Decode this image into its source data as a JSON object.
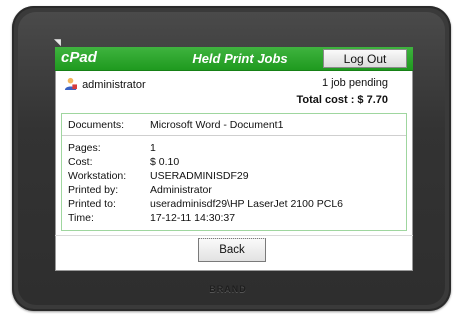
{
  "header": {
    "brand": "cPad",
    "title": "Held Print Jobs",
    "logout_label": "Log Out"
  },
  "summary": {
    "username": "administrator",
    "pending": "1 job pending",
    "total_cost": "Total cost : $ 7.70"
  },
  "job": {
    "documents_label": "Documents:",
    "documents_value": "Microsoft Word - Document1",
    "fields": [
      {
        "label": "Pages:",
        "value": "1"
      },
      {
        "label": "Cost:",
        "value": "$ 0.10"
      },
      {
        "label": "Workstation:",
        "value": "USERADMINISDF29"
      },
      {
        "label": "Printed by:",
        "value": "Administrator"
      },
      {
        "label": "Printed to:",
        "value": "useradminisdf29\\HP LaserJet 2100 PCL6"
      },
      {
        "label": "Time:",
        "value": "17-12-11 14:30:37"
      }
    ]
  },
  "footer": {
    "back_label": "Back"
  },
  "bezel": {
    "logo": "BRAND"
  },
  "icons": {
    "user": "user-icon",
    "corner": "corner-icon"
  },
  "colors": {
    "accent": "#2aa82a",
    "bezel": "#3a3a3a",
    "border": "#9fd69f"
  }
}
